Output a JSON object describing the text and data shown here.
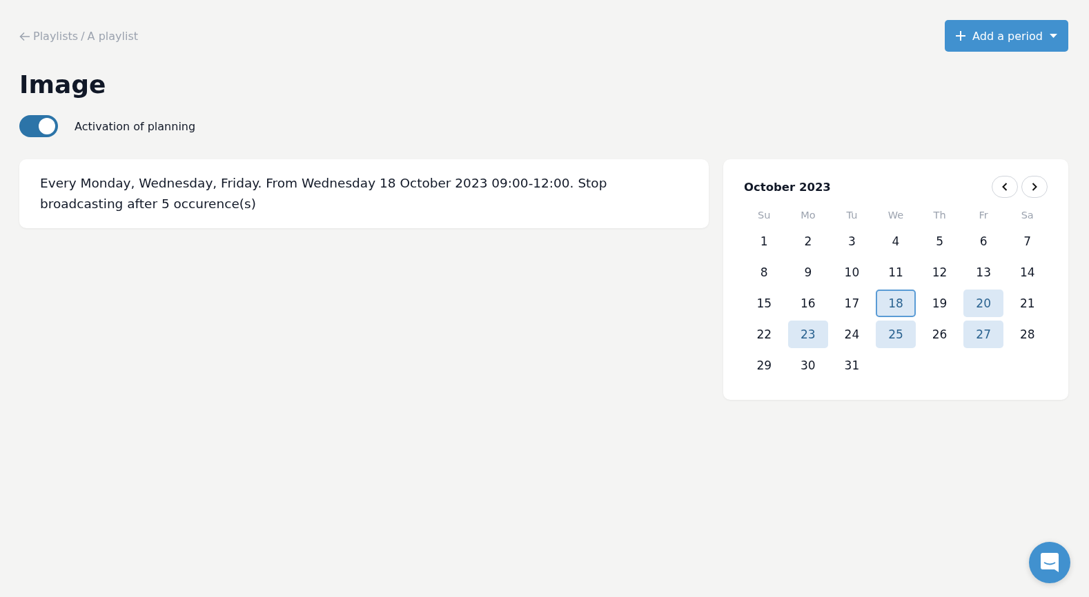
{
  "breadcrumb": {
    "parent": "Playlists",
    "separator": "/",
    "current": "A playlist"
  },
  "add_button": {
    "label": "Add a period"
  },
  "title": "Image",
  "planning_toggle": {
    "label": "Activation of planning",
    "on": true
  },
  "description": "Every Monday, Wednesday, Friday. From Wednesday 18 October 2023 09:00-12:00. Stop broadcasting after 5 occurence(s)",
  "calendar": {
    "month": "October 2023",
    "weekdays": [
      "Su",
      "Mo",
      "Tu",
      "We",
      "Th",
      "Fr",
      "Sa"
    ],
    "days": [
      {
        "label": "1",
        "scheduled": false,
        "selected": false
      },
      {
        "label": "2",
        "scheduled": false,
        "selected": false
      },
      {
        "label": "3",
        "scheduled": false,
        "selected": false
      },
      {
        "label": "4",
        "scheduled": false,
        "selected": false
      },
      {
        "label": "5",
        "scheduled": false,
        "selected": false
      },
      {
        "label": "6",
        "scheduled": false,
        "selected": false
      },
      {
        "label": "7",
        "scheduled": false,
        "selected": false
      },
      {
        "label": "8",
        "scheduled": false,
        "selected": false
      },
      {
        "label": "9",
        "scheduled": false,
        "selected": false
      },
      {
        "label": "10",
        "scheduled": false,
        "selected": false
      },
      {
        "label": "11",
        "scheduled": false,
        "selected": false
      },
      {
        "label": "12",
        "scheduled": false,
        "selected": false
      },
      {
        "label": "13",
        "scheduled": false,
        "selected": false
      },
      {
        "label": "14",
        "scheduled": false,
        "selected": false
      },
      {
        "label": "15",
        "scheduled": false,
        "selected": false
      },
      {
        "label": "16",
        "scheduled": false,
        "selected": false
      },
      {
        "label": "17",
        "scheduled": false,
        "selected": false
      },
      {
        "label": "18",
        "scheduled": true,
        "selected": true
      },
      {
        "label": "19",
        "scheduled": false,
        "selected": false
      },
      {
        "label": "20",
        "scheduled": true,
        "selected": false
      },
      {
        "label": "21",
        "scheduled": false,
        "selected": false
      },
      {
        "label": "22",
        "scheduled": false,
        "selected": false
      },
      {
        "label": "23",
        "scheduled": true,
        "selected": false
      },
      {
        "label": "24",
        "scheduled": false,
        "selected": false
      },
      {
        "label": "25",
        "scheduled": true,
        "selected": false
      },
      {
        "label": "26",
        "scheduled": false,
        "selected": false
      },
      {
        "label": "27",
        "scheduled": true,
        "selected": false
      },
      {
        "label": "28",
        "scheduled": false,
        "selected": false
      },
      {
        "label": "29",
        "scheduled": false,
        "selected": false
      },
      {
        "label": "30",
        "scheduled": false,
        "selected": false
      },
      {
        "label": "31",
        "scheduled": false,
        "selected": false
      }
    ]
  }
}
